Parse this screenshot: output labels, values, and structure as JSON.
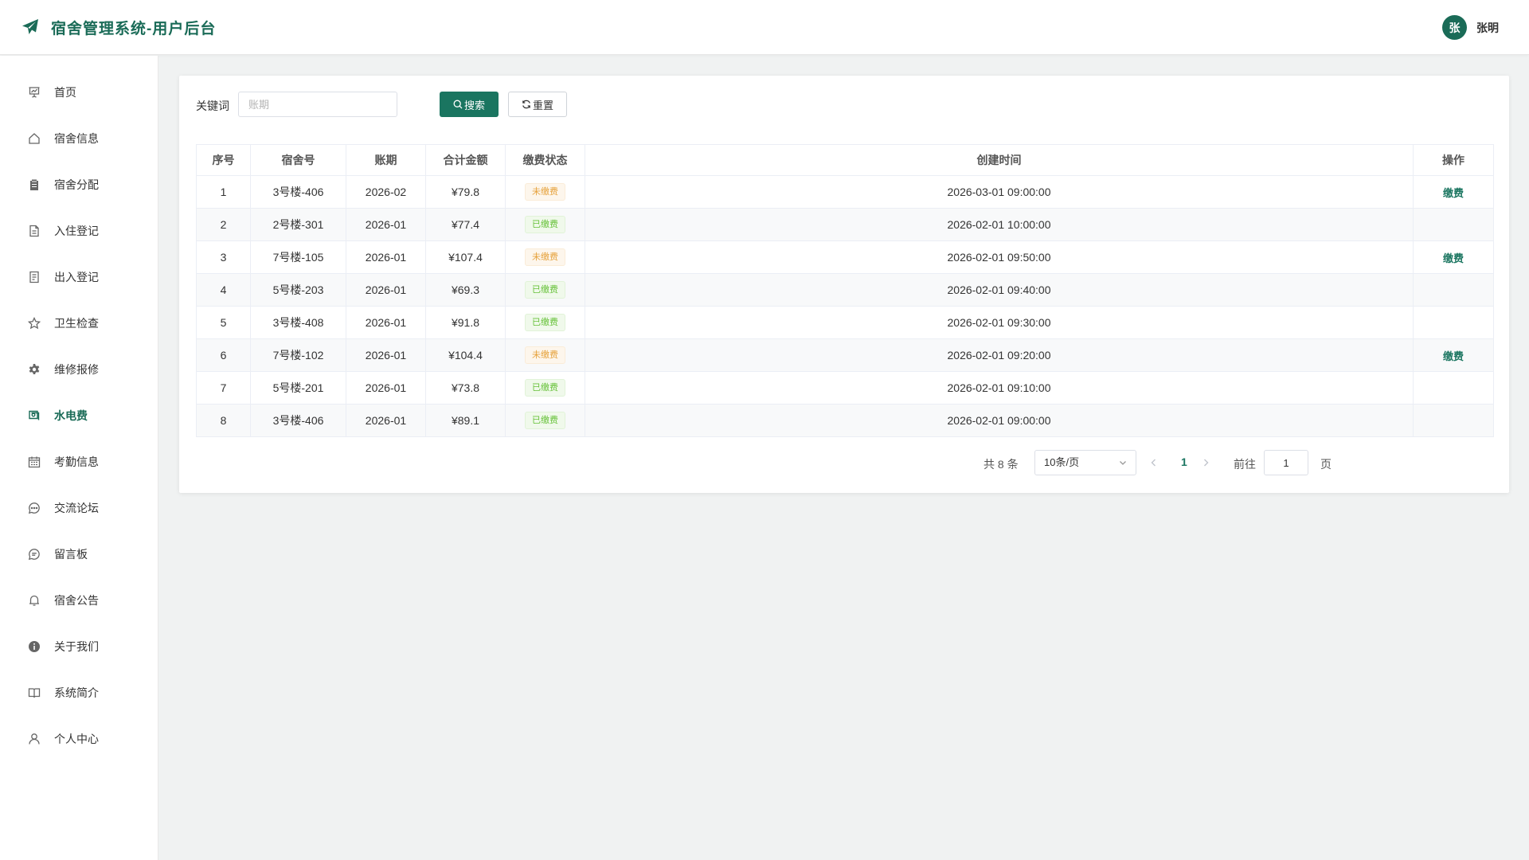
{
  "header": {
    "title": "宿舍管理系统-用户后台",
    "avatar_initial": "张",
    "username": "张明"
  },
  "sidebar": {
    "items": [
      {
        "label": "首页",
        "icon": "chart-board-icon"
      },
      {
        "label": "宿舍信息",
        "icon": "home-icon"
      },
      {
        "label": "宿舍分配",
        "icon": "clipboard-icon"
      },
      {
        "label": "入住登记",
        "icon": "document-icon"
      },
      {
        "label": "出入登记",
        "icon": "notes-icon"
      },
      {
        "label": "卫生检查",
        "icon": "star-icon"
      },
      {
        "label": "维修报修",
        "icon": "gear-icon"
      },
      {
        "label": "水电费",
        "icon": "money-icon",
        "active": true
      },
      {
        "label": "考勤信息",
        "icon": "calendar-icon"
      },
      {
        "label": "交流论坛",
        "icon": "chat-dots-icon"
      },
      {
        "label": "留言板",
        "icon": "chat-lines-icon"
      },
      {
        "label": "宿舍公告",
        "icon": "bell-icon"
      },
      {
        "label": "关于我们",
        "icon": "info-icon"
      },
      {
        "label": "系统简介",
        "icon": "book-icon"
      },
      {
        "label": "个人中心",
        "icon": "user-icon"
      }
    ]
  },
  "search": {
    "label": "关键词",
    "placeholder": "账期",
    "value": "",
    "search_label": "搜索",
    "reset_label": "重置"
  },
  "table": {
    "columns": [
      "序号",
      "宿舍号",
      "账期",
      "合计金额",
      "缴费状态",
      "创建时间",
      "操作"
    ],
    "rows": [
      {
        "no": "1",
        "room": "3号楼-406",
        "period": "2026-02",
        "amount": "¥79.8",
        "status": "未缴费",
        "status_type": "unpaid",
        "created": "2026-03-01 09:00:00",
        "action": "缴费"
      },
      {
        "no": "2",
        "room": "2号楼-301",
        "period": "2026-01",
        "amount": "¥77.4",
        "status": "已缴费",
        "status_type": "paid",
        "created": "2026-02-01 10:00:00",
        "action": ""
      },
      {
        "no": "3",
        "room": "7号楼-105",
        "period": "2026-01",
        "amount": "¥107.4",
        "status": "未缴费",
        "status_type": "unpaid",
        "created": "2026-02-01 09:50:00",
        "action": "缴费"
      },
      {
        "no": "4",
        "room": "5号楼-203",
        "period": "2026-01",
        "amount": "¥69.3",
        "status": "已缴费",
        "status_type": "paid",
        "created": "2026-02-01 09:40:00",
        "action": ""
      },
      {
        "no": "5",
        "room": "3号楼-408",
        "period": "2026-01",
        "amount": "¥91.8",
        "status": "已缴费",
        "status_type": "paid",
        "created": "2026-02-01 09:30:00",
        "action": ""
      },
      {
        "no": "6",
        "room": "7号楼-102",
        "period": "2026-01",
        "amount": "¥104.4",
        "status": "未缴费",
        "status_type": "unpaid",
        "created": "2026-02-01 09:20:00",
        "action": "缴费"
      },
      {
        "no": "7",
        "room": "5号楼-201",
        "period": "2026-01",
        "amount": "¥73.8",
        "status": "已缴费",
        "status_type": "paid",
        "created": "2026-02-01 09:10:00",
        "action": ""
      },
      {
        "no": "8",
        "room": "3号楼-406",
        "period": "2026-01",
        "amount": "¥89.1",
        "status": "已缴费",
        "status_type": "paid",
        "created": "2026-02-01 09:00:00",
        "action": ""
      }
    ]
  },
  "pagination": {
    "total_text": "共 8 条",
    "page_size": "10条/页",
    "current_page": "1",
    "goto_label": "前往",
    "goto_value": "1",
    "page_suffix": "页"
  },
  "colors": {
    "brand": "#1a6b57",
    "unpaid": "#e6a23c",
    "paid": "#67c23a"
  }
}
